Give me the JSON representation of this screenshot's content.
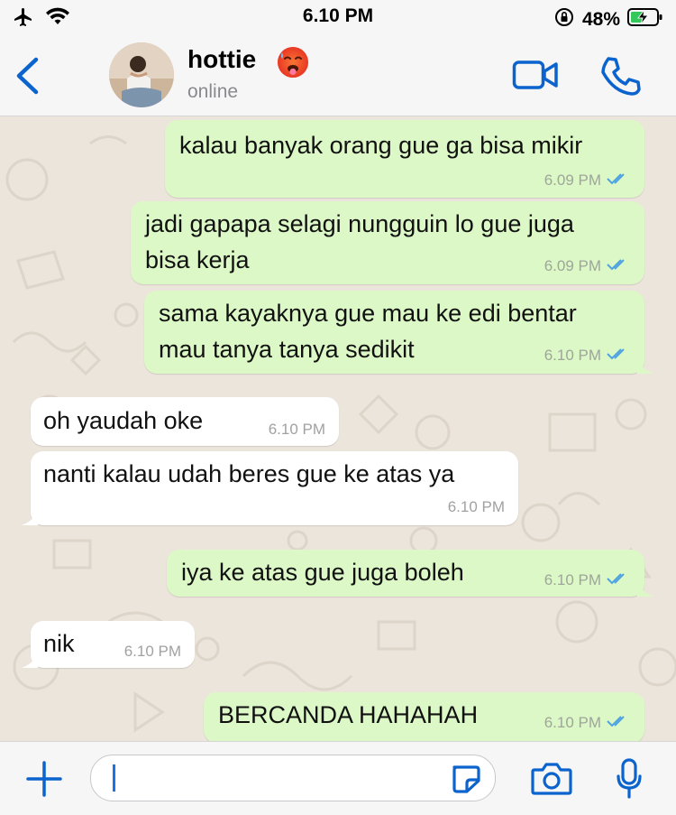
{
  "status_bar": {
    "time": "6.10 PM",
    "battery": "48%",
    "icons": [
      "airplane-icon",
      "wifi-icon",
      "rotation-lock-icon",
      "battery-charging-icon"
    ]
  },
  "header": {
    "contact_name": "hottie",
    "contact_emoji": "🥵",
    "contact_status": "online",
    "icons": [
      "back-chevron-icon",
      "video-call-icon",
      "phone-icon"
    ],
    "accent_color": "#0b63ce"
  },
  "messages": [
    {
      "direction": "out",
      "text": "kalau banyak orang gue ga bisa mikir",
      "time": "6.09 PM",
      "read": true
    },
    {
      "direction": "out",
      "lines": [
        "jadi gapapa selagi nungguin lo gue juga",
        "bisa kerja"
      ],
      "time": "6.09 PM",
      "read": true
    },
    {
      "direction": "out",
      "lines": [
        "sama kayaknya gue mau ke edi bentar",
        "mau tanya tanya sedikit"
      ],
      "time": "6.10 PM",
      "read": true
    },
    {
      "direction": "in",
      "text": "oh yaudah oke",
      "time": "6.10 PM"
    },
    {
      "direction": "in",
      "text": "nanti kalau udah beres gue ke atas ya",
      "time": "6.10 PM"
    },
    {
      "direction": "out",
      "text": "iya ke atas gue juga boleh",
      "time": "6.10 PM",
      "read": true
    },
    {
      "direction": "in",
      "text": "nik",
      "time": "6.10 PM"
    },
    {
      "direction": "out",
      "text": "BERCANDA HAHAHAH",
      "time": "6.10 PM",
      "read": true
    }
  ],
  "input_bar": {
    "value": "",
    "icons": [
      "plus-icon",
      "sticker-icon",
      "camera-icon",
      "microphone-icon"
    ]
  },
  "colors": {
    "outgoing_bubble": "#dcf8c6",
    "incoming_bubble": "#ffffff",
    "read_ticks": "#4fa3e0",
    "chat_background": "#ece5dc"
  }
}
